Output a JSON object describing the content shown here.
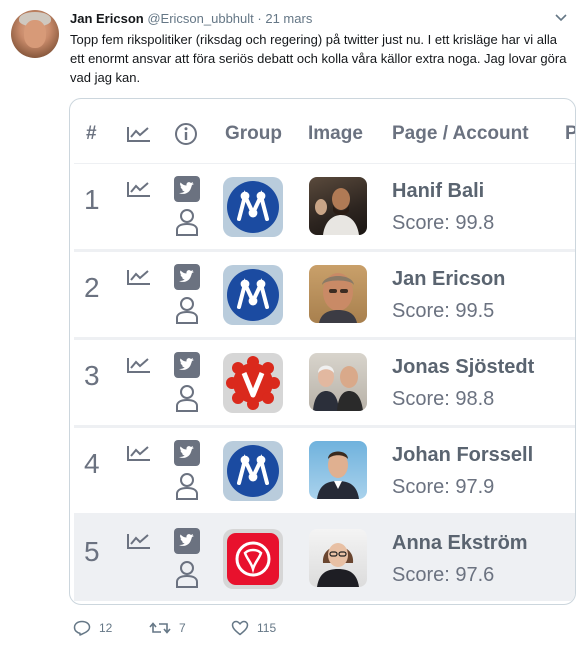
{
  "tweet": {
    "author_name": "Jan Ericson",
    "author_handle": "@Ericson_ubbhult",
    "separator": "·",
    "date": "21 mars",
    "text": "Topp fem rikspolitiker (riksdag och regering) på twitter just nu. I ett krisläge har vi alla ett enormt ansvar att föra seriös debatt och kolla våra källor extra noga. Jag lovar göra vad jag kan."
  },
  "table": {
    "headers": {
      "rank": "#",
      "trend": "trend-icon",
      "info": "info-icon",
      "group": "Group",
      "image": "Image",
      "page": "Page / Account",
      "cut": "P"
    },
    "rows": [
      {
        "rank": "1",
        "name": "Hanif Bali",
        "score": "Score: 99.8",
        "party_logo": "moderaterna-logo"
      },
      {
        "rank": "2",
        "name": "Jan Ericson",
        "score": "Score: 99.5",
        "party_logo": "moderaterna-logo"
      },
      {
        "rank": "3",
        "name": "Jonas Sjöstedt",
        "score": "Score: 98.8",
        "party_logo": "vansterpartiet-logo"
      },
      {
        "rank": "4",
        "name": "Johan Forssell",
        "score": "Score: 97.9",
        "party_logo": "moderaterna-logo"
      },
      {
        "rank": "5",
        "name": "Anna Ekström",
        "score": "Score: 97.6",
        "party_logo": "socialdemokraterna-logo"
      }
    ]
  },
  "actions": {
    "replies": "12",
    "retweets": "7",
    "likes": "115"
  },
  "colors": {
    "moderaterna_blue": "#1b4ba1",
    "vansterpartiet_red": "#da291c",
    "socialdemokraterna_red": "#e8112d",
    "icon_gray": "#6b7280",
    "retweet_green": "#657786"
  }
}
